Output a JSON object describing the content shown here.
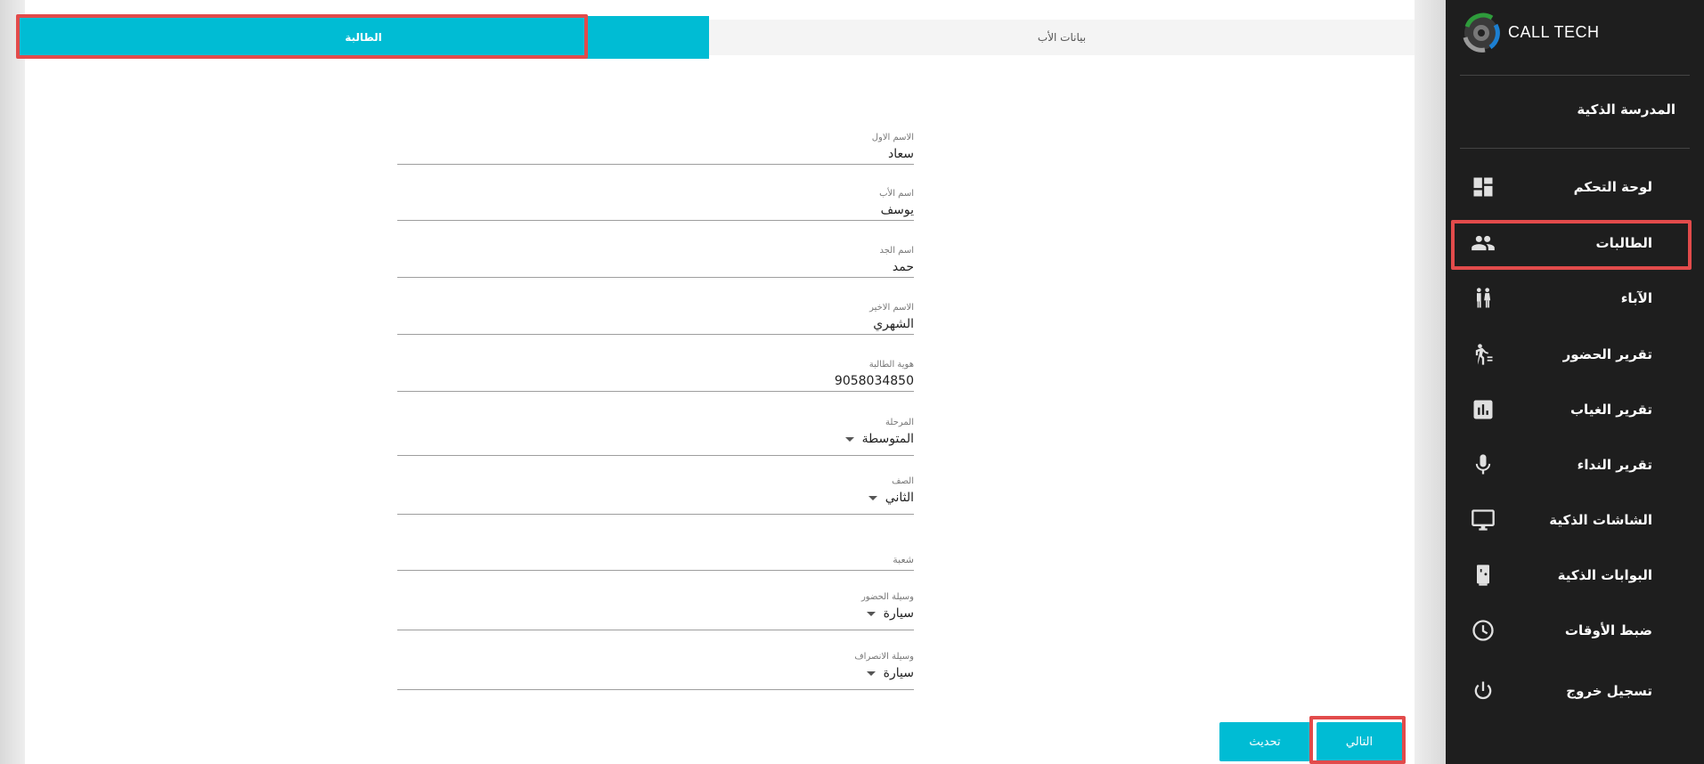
{
  "tabs": {
    "student": "الطالبة",
    "parent": "بيانات الأب"
  },
  "form": {
    "first_name": {
      "label": "الاسم الاول",
      "value": "سعاد"
    },
    "father_name": {
      "label": "اسم الأب",
      "value": "يوسف"
    },
    "grandfather_name": {
      "label": "اسم الجد",
      "value": "حمد"
    },
    "last_name": {
      "label": "الاسم الاخير",
      "value": "الشهري"
    },
    "student_id": {
      "label": "هوية الطالبة",
      "value": "9058034850"
    },
    "stage": {
      "label": "المرحلة",
      "value": "المتوسطة"
    },
    "grade": {
      "label": "الصف",
      "value": "الثاني"
    },
    "section": {
      "placeholder": "شعبة"
    },
    "arrival_method": {
      "label": "وسيلة الحضور",
      "value": "سيارة"
    },
    "departure_method": {
      "label": "وسيلة الانصراف",
      "value": "سيارة"
    }
  },
  "buttons": {
    "update": "تحديث",
    "next": "التالي"
  },
  "sidebar": {
    "brand": "CALL TECH",
    "school": "المدرسة الذكية",
    "items": [
      {
        "label": "لوحة التحكم",
        "icon": "dashboard-icon"
      },
      {
        "label": "الطالبات",
        "icon": "people-icon"
      },
      {
        "label": "الآباء",
        "icon": "family-icon"
      },
      {
        "label": "تقرير الحضور",
        "icon": "walk-icon"
      },
      {
        "label": "تقرير الغياب",
        "icon": "bar-chart-icon"
      },
      {
        "label": "تقرير النداء",
        "icon": "mic-icon"
      },
      {
        "label": "الشاشات الذكية",
        "icon": "monitor-icon"
      },
      {
        "label": "البوابات الذكية",
        "icon": "door-icon"
      },
      {
        "label": "ضبط الأوقات",
        "icon": "clock-icon"
      },
      {
        "label": "تسجيل خروج",
        "icon": "power-icon"
      }
    ]
  },
  "colors": {
    "accent": "#00bcd4",
    "sidebar_bg": "#1e1e1e",
    "highlight": "#e24b4b"
  }
}
